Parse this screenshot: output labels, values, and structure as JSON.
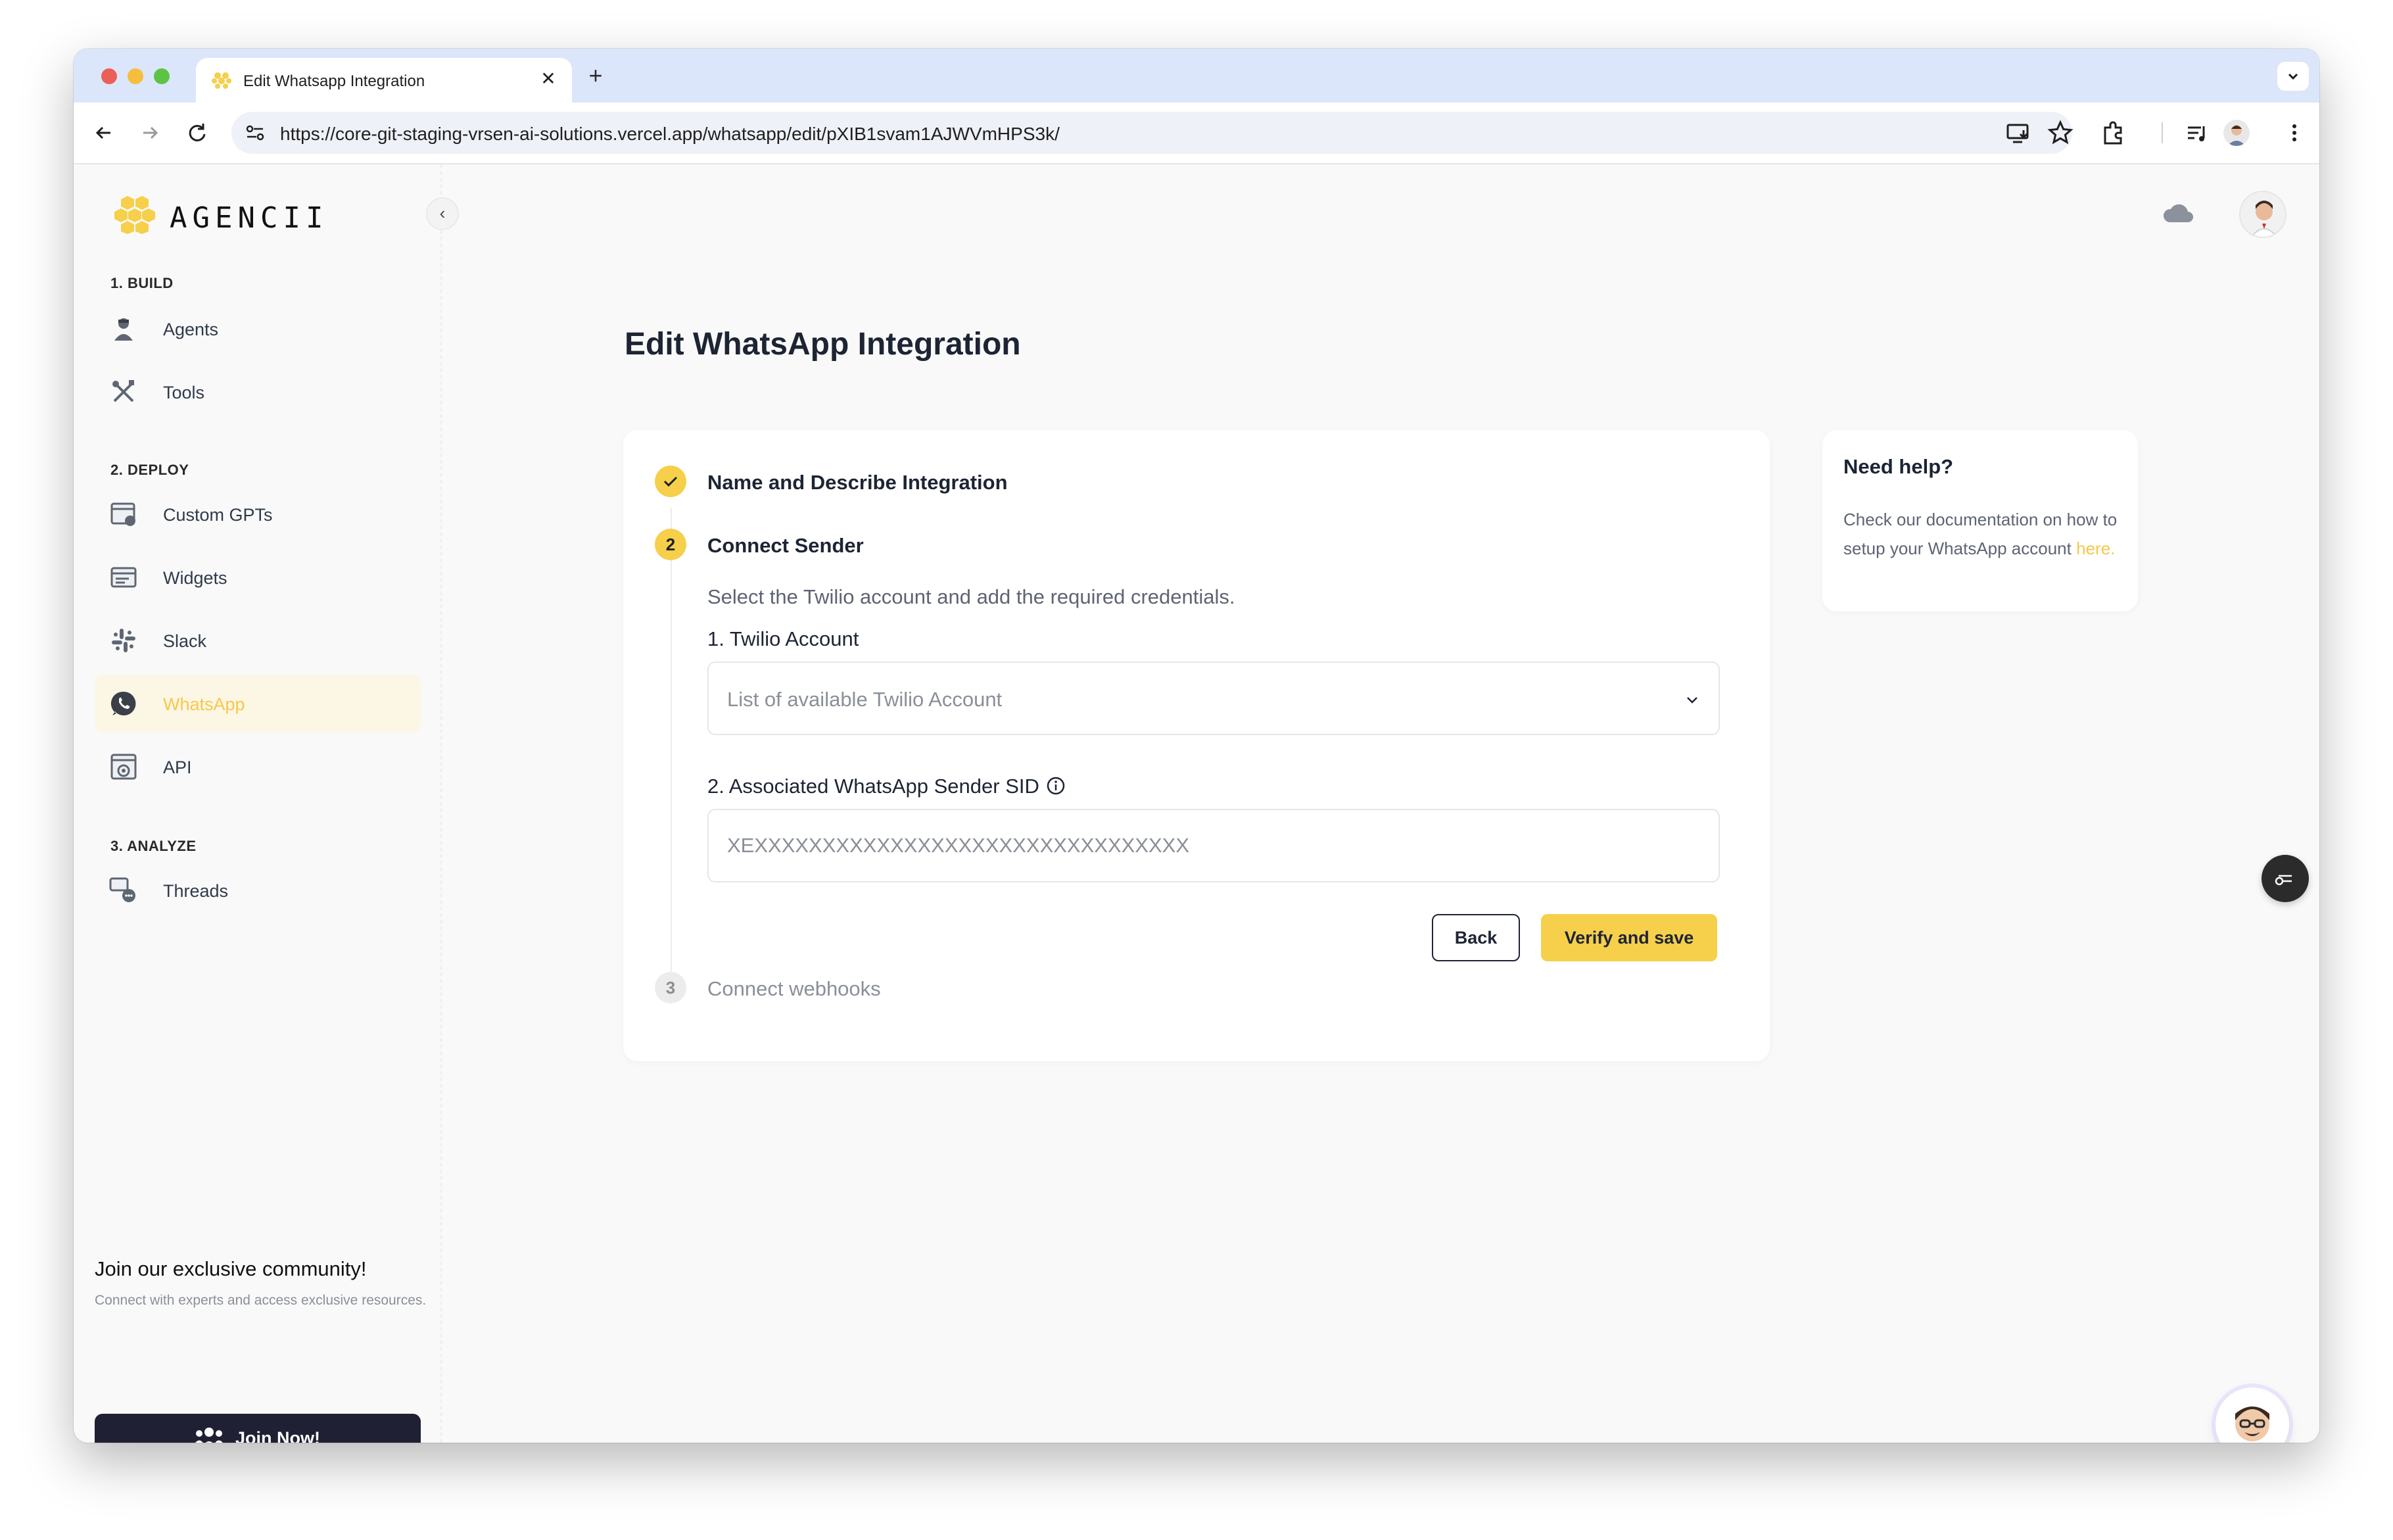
{
  "browser": {
    "tab_title": "Edit Whatsapp Integration",
    "tab_close": "✕",
    "new_tab": "+",
    "url": "https://core-git-staging-vrsen-ai-solutions.vercel.app/whatsapp/edit/pXIB1svam1AJWVmHPS3k/"
  },
  "sidebar": {
    "brand": "AGENCII",
    "collapse_glyph": "‹",
    "sections": [
      {
        "title": "1. BUILD",
        "items": [
          {
            "label": "Agents",
            "icon": "agent-icon"
          },
          {
            "label": "Tools",
            "icon": "tools-icon"
          }
        ]
      },
      {
        "title": "2. DEPLOY",
        "items": [
          {
            "label": "Custom GPTs",
            "icon": "custom-gpt-icon"
          },
          {
            "label": "Widgets",
            "icon": "widget-icon"
          },
          {
            "label": "Slack",
            "icon": "slack-icon"
          },
          {
            "label": "WhatsApp",
            "icon": "whatsapp-icon",
            "active": true
          },
          {
            "label": "API",
            "icon": "api-icon"
          }
        ]
      },
      {
        "title": "3. ANALYZE",
        "items": [
          {
            "label": "Threads",
            "icon": "threads-icon"
          }
        ]
      }
    ],
    "community": {
      "title": "Join our exclusive community!",
      "description": "Connect with experts and access exclusive resources.",
      "button_label": "Join Now!"
    }
  },
  "main": {
    "page_title": "Edit WhatsApp Integration",
    "steps": [
      {
        "number": "",
        "title": "Name and Describe Integration",
        "state": "done"
      },
      {
        "number": "2",
        "title": "Connect Sender",
        "state": "active",
        "description": "Select the Twilio account and add the required credentials."
      },
      {
        "number": "3",
        "title": "Connect webhooks",
        "state": "pending"
      }
    ],
    "form": {
      "twilio_label": "1. Twilio Account",
      "twilio_placeholder": "List of available Twilio Account",
      "sid_label": "2. Associated WhatsApp Sender SID",
      "sid_placeholder": "XEXXXXXXXXXXXXXXXXXXXXXXXXXXXXXXXX",
      "back_label": "Back",
      "verify_label": "Verify and save"
    },
    "help": {
      "title": "Need help?",
      "text": "Check our documentation on how to setup your WhatsApp account",
      "link": "here."
    }
  },
  "colors": {
    "accent": "#f6cf4b",
    "active_bg": "#fcf6e5",
    "dark": "#1f2033",
    "muted": "#8a8f98"
  }
}
